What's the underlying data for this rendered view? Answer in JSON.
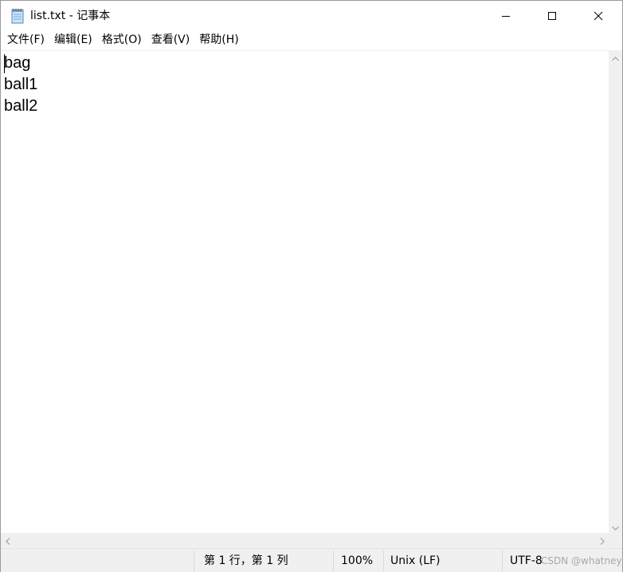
{
  "window": {
    "title": "list.txt - 记事本"
  },
  "menu": {
    "items": [
      "文件(F)",
      "编辑(E)",
      "格式(O)",
      "查看(V)",
      "帮助(H)"
    ]
  },
  "editor": {
    "lines": [
      "bag",
      "ball1",
      "ball2"
    ]
  },
  "statusbar": {
    "position": "第 1 行，第 1 列",
    "zoom": "100%",
    "line_ending": "Unix (LF)",
    "encoding": "UTF-8",
    "watermark": "CSDN @whatney"
  },
  "icons": {
    "app": "notepad-icon",
    "minimize": "minimize-icon",
    "maximize": "maximize-icon",
    "close": "close-icon"
  },
  "colors": {
    "chrome": "#f0f0f0",
    "editor_bg": "#ffffff"
  }
}
